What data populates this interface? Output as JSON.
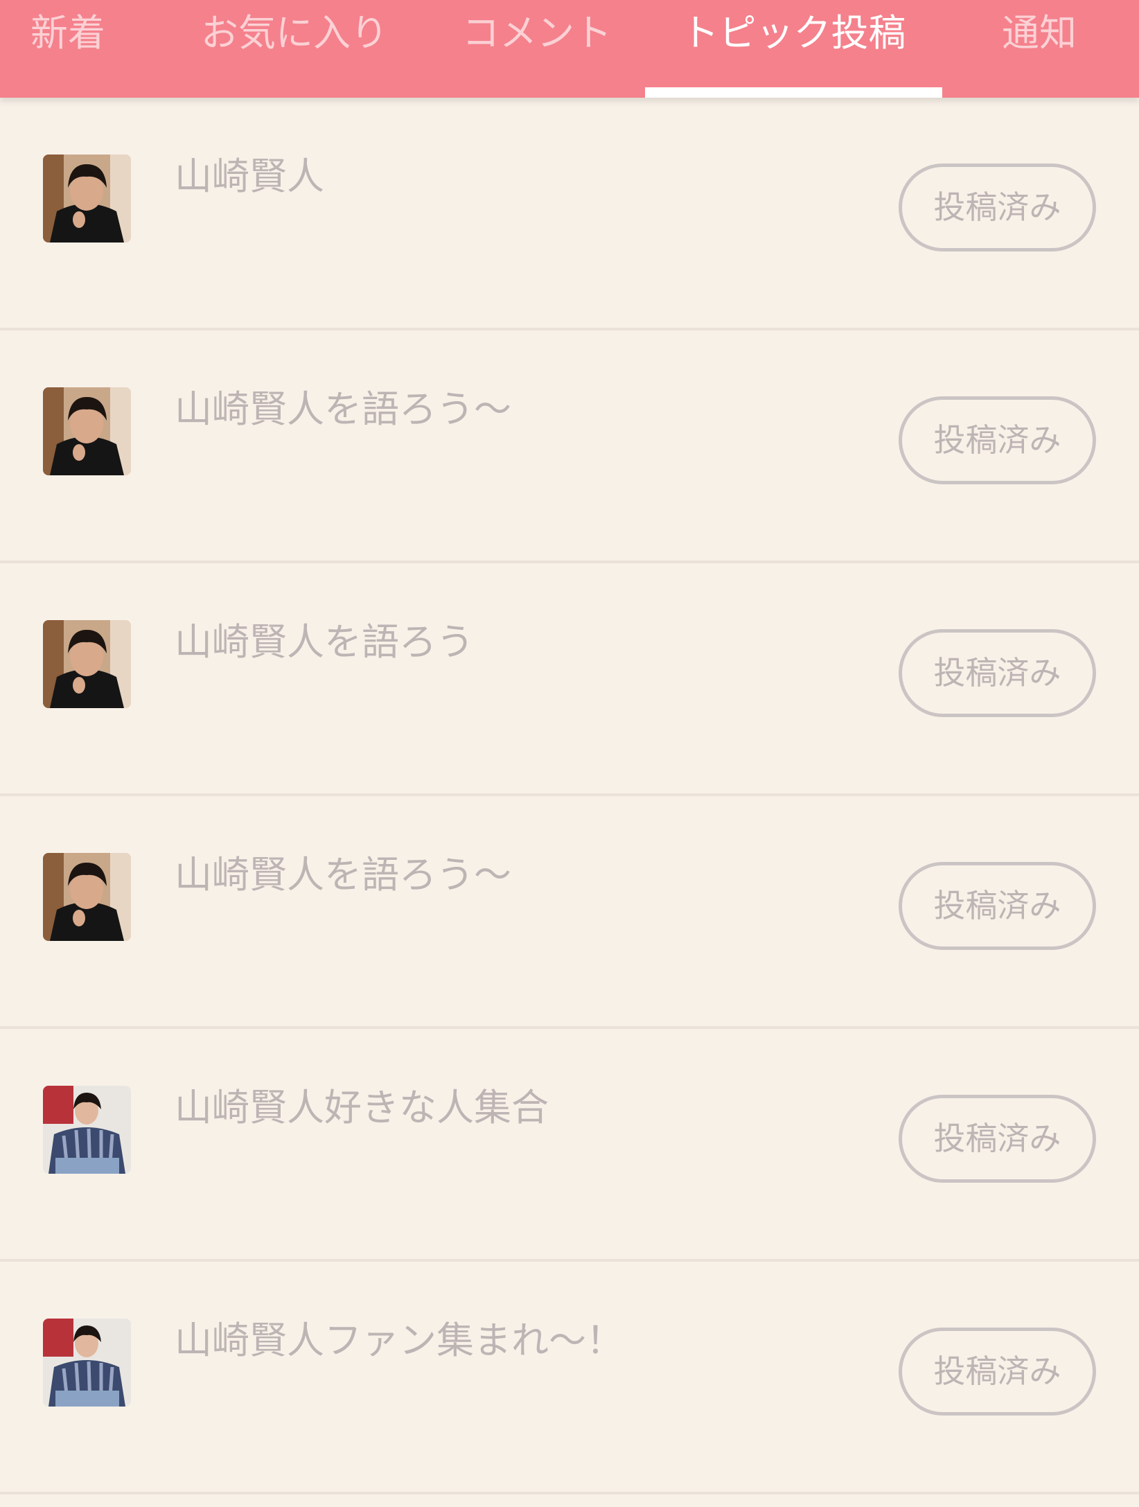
{
  "tabs": [
    {
      "label": "新着",
      "active": false
    },
    {
      "label": "お気に入り",
      "active": false
    },
    {
      "label": "コメント",
      "active": false
    },
    {
      "label": "トピック投稿",
      "active": true
    },
    {
      "label": "通知",
      "active": false
    }
  ],
  "topics": [
    {
      "title": "山崎賢人",
      "status": "投稿済み",
      "avatar": "dark-coat-photo"
    },
    {
      "title": "山崎賢人を語ろう〜",
      "status": "投稿済み",
      "avatar": "dark-coat-photo"
    },
    {
      "title": "山崎賢人を語ろう",
      "status": "投稿済み",
      "avatar": "dark-coat-photo"
    },
    {
      "title": "山崎賢人を語ろう〜",
      "status": "投稿済み",
      "avatar": "dark-coat-photo"
    },
    {
      "title": "山崎賢人好きな人集合",
      "status": "投稿済み",
      "avatar": "striped-shirt-photo"
    },
    {
      "title": "山崎賢人ファン集まれ〜！",
      "status": "投稿済み",
      "avatar": "striped-shirt-photo"
    }
  ],
  "colors": {
    "header": "#f4818c",
    "background": "#f8f1e8",
    "muted_text": "#bdb4b4",
    "active_tab": "#ffffff"
  }
}
